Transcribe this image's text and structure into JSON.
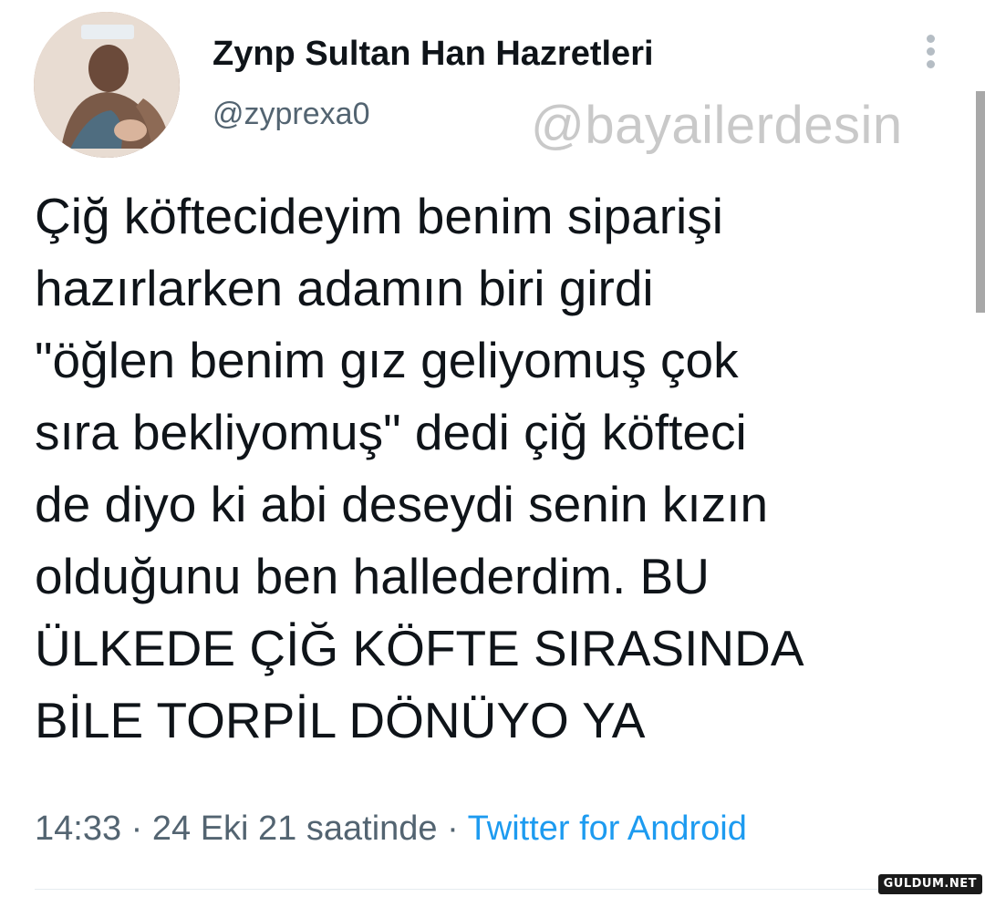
{
  "author": {
    "display_name": "Zynp Sultan Han Hazretleri",
    "handle": "@zyprexa0"
  },
  "watermark": "@bayailerdesin",
  "tweet": {
    "lines": [
      "Çiğ köftecideyim benim siparişi",
      "hazırlarken adamın biri girdi",
      "\"öğlen benim gız geliyomuş çok",
      "sıra bekliyomuş\" dedi çiğ köfteci",
      "de diyo ki abi deseydi senin kızın",
      "olduğunu ben hallederdim. BU",
      "ÜLKEDE ÇİĞ KÖFTE SIRASINDA",
      "BİLE TORPİL DÖNÜYO YA"
    ]
  },
  "meta": {
    "time": "14:33",
    "separator": " · ",
    "date": "24 Eki 21 saatinde",
    "source": "Twitter for Android"
  },
  "site_badge": "GULDUM.NET",
  "icons": {
    "more": "more-vertical-icon",
    "avatar": "profile-avatar"
  },
  "colors": {
    "text": "#0f1419",
    "secondary": "#536471",
    "link": "#1d9bf0",
    "watermark": "#c9c9c9"
  }
}
